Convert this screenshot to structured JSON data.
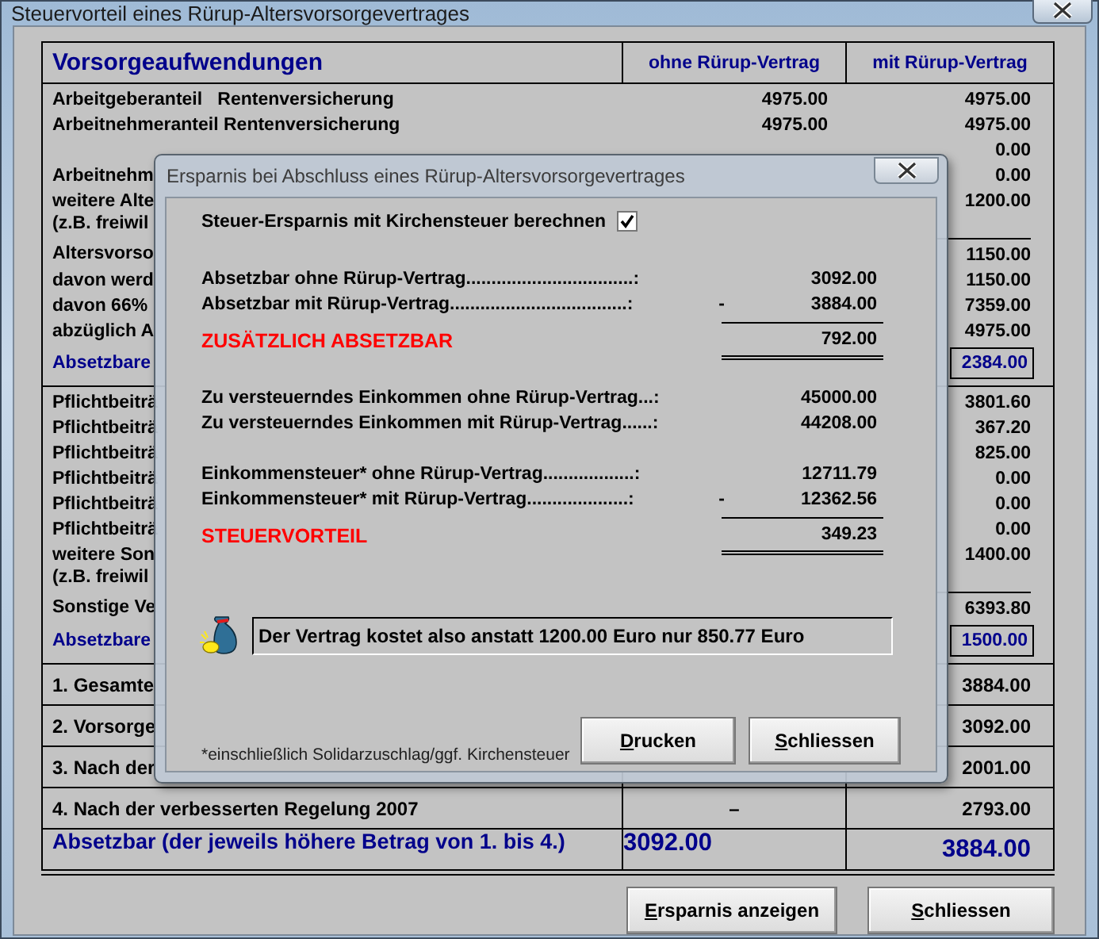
{
  "window": {
    "title": "Steuervorteil eines Rürup-Altersvorsorgevertrages"
  },
  "table": {
    "columns": [
      "Vorsorgeaufwendungen",
      "ohne Rürup-Vertrag",
      "mit Rürup-Vertrag"
    ],
    "sections": [
      {
        "rows": [
          {
            "kind": "item",
            "label": "Arbeitgeberanteil   Rentenversicherung",
            "ohne": "4975.00",
            "mit": "4975.00"
          },
          {
            "kind": "item",
            "label": "Arbeitnehmeranteil Rentenversicherung",
            "ohne": "4975.00",
            "mit": "4975.00"
          },
          {
            "kind": "item",
            "mit": "0.00"
          },
          {
            "kind": "item",
            "label": "Arbeitnehm",
            "mit": "0.00"
          },
          {
            "kind": "item",
            "label": "weitere Alte",
            "note": "(z.B. freiwil",
            "mit": "1200.00"
          },
          {
            "kind": "sum",
            "label": "Altersvorso",
            "mit": "1150.00"
          },
          {
            "kind": "item",
            "label": "davon werd",
            "mit": "1150.00"
          },
          {
            "kind": "item",
            "label": "davon 66%",
            "mit": "7359.00"
          },
          {
            "kind": "item",
            "label": "abzüglich A",
            "mit": "4975.00"
          },
          {
            "kind": "result",
            "label": "Absetzbare",
            "mit": "2384.00"
          }
        ]
      },
      {
        "rows": [
          {
            "kind": "item",
            "label": "Pflichtbeiträ",
            "mit": "3801.60"
          },
          {
            "kind": "item",
            "label": "Pflichtbeiträ",
            "mit": "367.20"
          },
          {
            "kind": "item",
            "label": "Pflichtbeiträ",
            "mit": "825.00"
          },
          {
            "kind": "item",
            "label": "Pflichtbeiträ",
            "mit": "0.00"
          },
          {
            "kind": "item",
            "label": "Pflichtbeiträ",
            "mit": "0.00"
          },
          {
            "kind": "item",
            "label": "Pflichtbeiträ",
            "mit": "0.00"
          },
          {
            "kind": "item",
            "label": "weitere Son",
            "note": "(z.B. freiwil",
            "mit": "1400.00"
          },
          {
            "kind": "sum",
            "label": "Sonstige Ve",
            "mit": "6393.80"
          },
          {
            "kind": "result",
            "label": "Absetzbare",
            "mit": "1500.00"
          }
        ]
      }
    ],
    "summary": [
      {
        "kind": "item",
        "label": "1. Gesamte",
        "mit": "3884.00"
      },
      {
        "kind": "item",
        "label": "2. Vorsorge",
        "mit": "3092.00"
      },
      {
        "kind": "item",
        "label": "3. Nach der",
        "mit": "2001.00"
      },
      {
        "kind": "item",
        "label": "4. Nach der verbesserten Regelung 2007",
        "ohne": "–",
        "mit": "2793.00"
      },
      {
        "kind": "total",
        "label": "Absetzbar (der jeweils höhere Betrag von 1. bis 4.)",
        "ohne": "3092.00",
        "mit": "3884.00"
      }
    ]
  },
  "buttons": [
    "Ersparnis anzeigen",
    "Schliessen"
  ],
  "dialog": {
    "title": "Ersparnis bei Abschluss eines Rürup-Altersvorsorgevertrages",
    "kirchensteuer": {
      "label": "Steuer-Ersparnis mit Kirchensteuer berechnen",
      "checked": true
    },
    "groups": [
      {
        "rows": [
          {
            "kind": "item",
            "label": "Absetzbar ohne Rürup-Vertrag.................................:",
            "value": "3092.00"
          },
          {
            "kind": "item",
            "label": "Absetzbar mit Rürup-Vertrag...................................:",
            "operator": "-",
            "value": "3884.00"
          },
          {
            "kind": "result",
            "label": "ZUSÄTZLICH ABSETZBAR",
            "value": "792.00"
          }
        ]
      },
      {
        "rows": [
          {
            "kind": "item",
            "label": "Zu versteuerndes Einkommen ohne Rürup-Vertrag...:",
            "value": "45000.00"
          },
          {
            "kind": "item",
            "label": "Zu versteuerndes Einkommen mit Rürup-Vertrag......:",
            "value": "44208.00"
          }
        ]
      },
      {
        "rows": [
          {
            "kind": "item",
            "label": "Einkommensteuer* ohne Rürup-Vertrag..................:",
            "value": "12711.79"
          },
          {
            "kind": "item",
            "label": "Einkommensteuer* mit Rürup-Vertrag....................:",
            "operator": "-",
            "value": "12362.56"
          },
          {
            "kind": "result",
            "label": "STEUERVORTEIL",
            "value": "349.23"
          }
        ]
      }
    ],
    "message": "Der Vertrag kostet also anstatt 1200.00 Euro nur 850.77 Euro",
    "footnote": "*einschließlich Solidarzuschlag/ggf. Kirchensteuer",
    "buttons": [
      "Drucken",
      "Schliessen"
    ]
  }
}
